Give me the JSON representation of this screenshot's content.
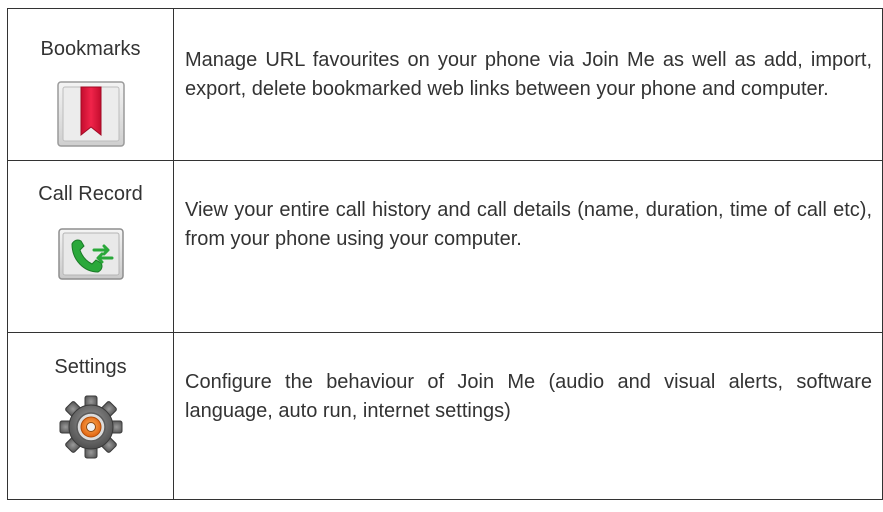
{
  "features": [
    {
      "name": "Bookmarks",
      "icon": "bookmark-icon",
      "description": "Manage URL favourites on your phone via Join Me as well as add, import, export, delete bookmarked web links between your phone and computer."
    },
    {
      "name": "Call Record",
      "icon": "call-record-icon",
      "description": "View your entire call history and call details (name, duration, time of call etc), from your phone using your computer."
    },
    {
      "name": "Settings",
      "icon": "settings-gear-icon",
      "description": "Configure the behaviour of Join Me (audio and visual alerts, software language, auto run, internet settings)"
    }
  ],
  "colors": {
    "bookmark_red": "#e0143a",
    "call_green": "#2aa83a",
    "gear_gray": "#6b6b6b",
    "gear_orange": "#f07a1e"
  }
}
